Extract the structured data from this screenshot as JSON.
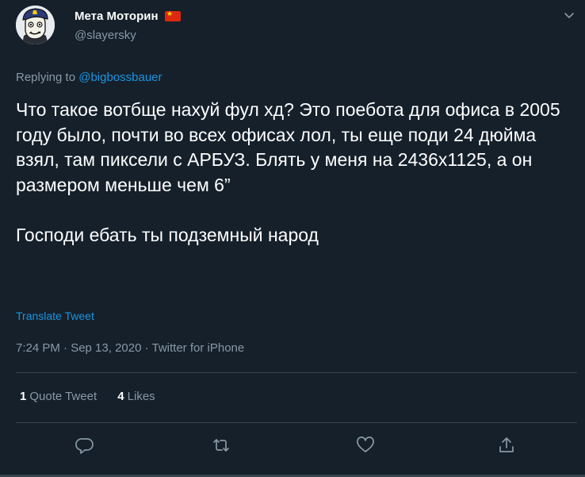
{
  "author": {
    "display_name": "Мета Моторин",
    "handle": "@slayersky",
    "flag_icon": "china-flag-icon"
  },
  "reply": {
    "prefix": "Replying to ",
    "mention": "@bigbossbauer"
  },
  "tweet": {
    "text": "Что такое вотбще нахуй фул хд? Это поебота для офиса в 2005 году было, почти во всех офисах лол, ты еще поди 24 дюйма взял, там пиксели с АРБУЗ. Блять у меня на 2436x1125, а он размером меньше чем 6”\n\nГосподи ебать ты подземный народ",
    "translate_label": "Translate Tweet",
    "timestamp": "7:24 PM · Sep 13, 2020 · Twitter for iPhone"
  },
  "stats": {
    "quote_count": "1",
    "quote_label": "Quote Tweet",
    "like_count": "4",
    "like_label": "Likes"
  },
  "actions": [
    "reply-icon",
    "retweet-icon",
    "like-icon",
    "share-icon"
  ],
  "colors": {
    "background": "#15202b",
    "text": "#ffffff",
    "secondary": "#8899a6",
    "accent": "#1b95e0",
    "divider": "#38444d"
  }
}
